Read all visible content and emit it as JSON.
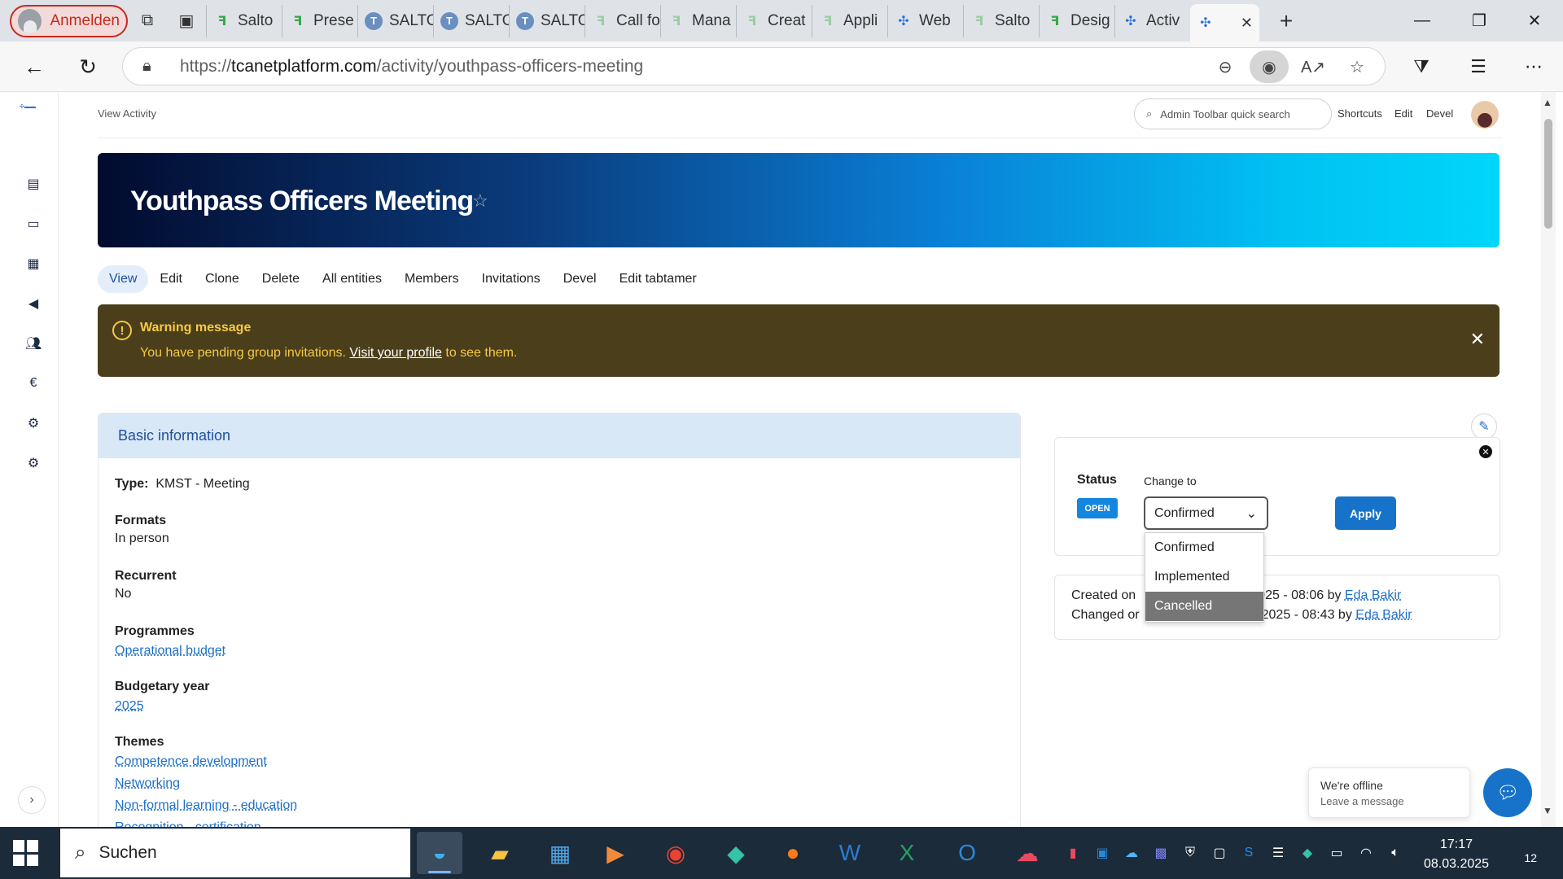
{
  "browser": {
    "profile_label": "Anmelden",
    "tabs": [
      {
        "label": "Salto",
        "icon": "salto-icon"
      },
      {
        "label": "Prese",
        "icon": "salto-icon"
      },
      {
        "label": "SALTO",
        "icon": "t-icon"
      },
      {
        "label": "SALTO",
        "icon": "t-icon"
      },
      {
        "label": "SALTO",
        "icon": "t-icon"
      },
      {
        "label": "Call fo",
        "icon": "salto-icon"
      },
      {
        "label": "Mana",
        "icon": "salto-icon"
      },
      {
        "label": "Creat",
        "icon": "salto-icon"
      },
      {
        "label": "Appli",
        "icon": "salto-icon"
      },
      {
        "label": "Web",
        "icon": "tca-icon"
      },
      {
        "label": "Salto",
        "icon": "salto-icon"
      },
      {
        "label": "Desig",
        "icon": "salto-icon"
      },
      {
        "label": "Activ",
        "icon": "tca-icon"
      },
      {
        "label": "",
        "icon": "tca-icon"
      }
    ],
    "active_tab_close": "✕",
    "new_tab": "+",
    "url_scheme": "https://",
    "url_host": "tcanetplatform.com",
    "url_path": "/activity/youthpass-officers-meeting"
  },
  "page": {
    "breadcrumb": "View Activity",
    "admin_search_placeholder": "Admin Toolbar quick search",
    "admin_links": [
      "Shortcuts",
      "Edit",
      "Devel"
    ],
    "title": "Youthpass Officers Meeting",
    "tabs": [
      "View",
      "Edit",
      "Clone",
      "Delete",
      "All entities",
      "Members",
      "Invitations",
      "Devel",
      "Edit tabtamer"
    ],
    "warning": {
      "title": "Warning message",
      "text_before": "You have pending group invitations. ",
      "link": "Visit your profile",
      "text_after": " to see them."
    },
    "basic": {
      "heading": "Basic information",
      "type_label": "Type:",
      "type_value": "KMST - Meeting",
      "formats_label": "Formats",
      "formats_value": "In person",
      "recurrent_label": "Recurrent",
      "recurrent_value": "No",
      "programmes_label": "Programmes",
      "programmes_value": "Operational budget",
      "budget_label": "Budgetary year",
      "budget_value": "2025",
      "themes_label": "Themes",
      "themes": [
        "Competence development",
        "Networking",
        "Non-formal learning - education",
        "Recognition - certification"
      ]
    },
    "status": {
      "label": "Status",
      "badge": "OPEN",
      "change_label": "Change to",
      "selected": "Confirmed",
      "apply": "Apply",
      "options": [
        "Confirmed",
        "Implemented",
        "Cancelled"
      ],
      "highlighted": "Cancelled"
    },
    "meta": {
      "created_prefix": "Created on",
      "created_suffix": "025 - 08:06 by ",
      "created_by": "Eda Bakir",
      "changed_prefix": "Changed or",
      "changed_suffix": "2025 - 08:43 by ",
      "changed_by": "Eda Bakir"
    },
    "chat": {
      "line1": "We're offline",
      "line2": "Leave a message"
    }
  },
  "taskbar": {
    "search_label": "Suchen",
    "time": "17:17",
    "date": "08.03.2025",
    "notifications": "12"
  }
}
